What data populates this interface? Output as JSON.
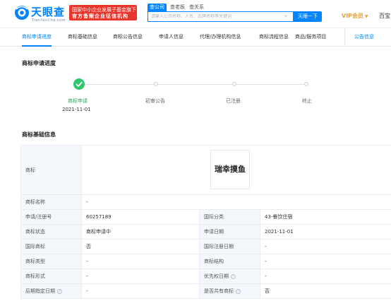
{
  "header": {
    "logo_name": "天眼查",
    "logo_domain": "TianYanCha.com",
    "badge_line1": "国家中小企业发展子基金旗下",
    "badge_line2": "官方备案企业征信机构",
    "search_tabs": [
      {
        "label": "查公司",
        "active": true
      },
      {
        "label": "查老板",
        "active": false
      },
      {
        "label": "查关系",
        "active": false
      }
    ],
    "search_placeholder": "请输入公司名称、人名、品牌名称等关键词",
    "clear_icon": "×",
    "search_button": "天眼一下",
    "vip_label": "VIP会员",
    "vip_caret": "▼",
    "baibao": "百宝"
  },
  "tabs": [
    {
      "label": "商标申请进度",
      "active": true
    },
    {
      "label": "商标基础信息",
      "active": false
    },
    {
      "label": "商标公告信息",
      "active": false
    },
    {
      "label": "申请人信息",
      "active": false
    },
    {
      "label": "代理/办理机构信息",
      "active": false
    },
    {
      "label": "商标流程信息",
      "active": false
    },
    {
      "label": "商品/服务项目",
      "active": false
    },
    {
      "label": "公告信息",
      "active": false
    }
  ],
  "progress": {
    "title": "商标申请进度",
    "steps": [
      {
        "label": "商标申请",
        "date": "2021-11-01",
        "done": true
      },
      {
        "label": "初审公告",
        "done": false
      },
      {
        "label": "已注册",
        "done": false
      },
      {
        "label": "终止",
        "done": false
      }
    ]
  },
  "basic_info": {
    "title": "商标基础信息",
    "trademark_label": "商标",
    "trademark_text": "瑞幸摸鱼",
    "rows": [
      {
        "k1": "商标名称",
        "v1": "-"
      },
      {
        "k1": "申请/注册号",
        "v1": "60257189",
        "k2": "国际分类",
        "v2": "43-餐饮住宿"
      },
      {
        "k1": "商标状态",
        "v1": "商标申请中",
        "k2": "申请日期",
        "v2": "2021-11-01"
      },
      {
        "k1": "国际商标",
        "v1": "否",
        "k2": "国际注册日期",
        "v2": "-"
      },
      {
        "k1": "商标类型",
        "v1": "-",
        "k2": "商标结构",
        "v2": "-"
      },
      {
        "k1": "商标形式",
        "v1": "-",
        "k2": "优先权日期",
        "v2": "-"
      },
      {
        "k1": "后期指定日期",
        "v1": "-",
        "k2": "是否共有商标",
        "v2": "否"
      }
    ],
    "help_icon": "?"
  },
  "colors": {
    "brand_blue": "#0084ff",
    "success_green": "#2ec86b",
    "badge_red": "#e8362c",
    "vip_gold": "#e6a23c",
    "key_cell_bg": "#f4f8fc"
  }
}
